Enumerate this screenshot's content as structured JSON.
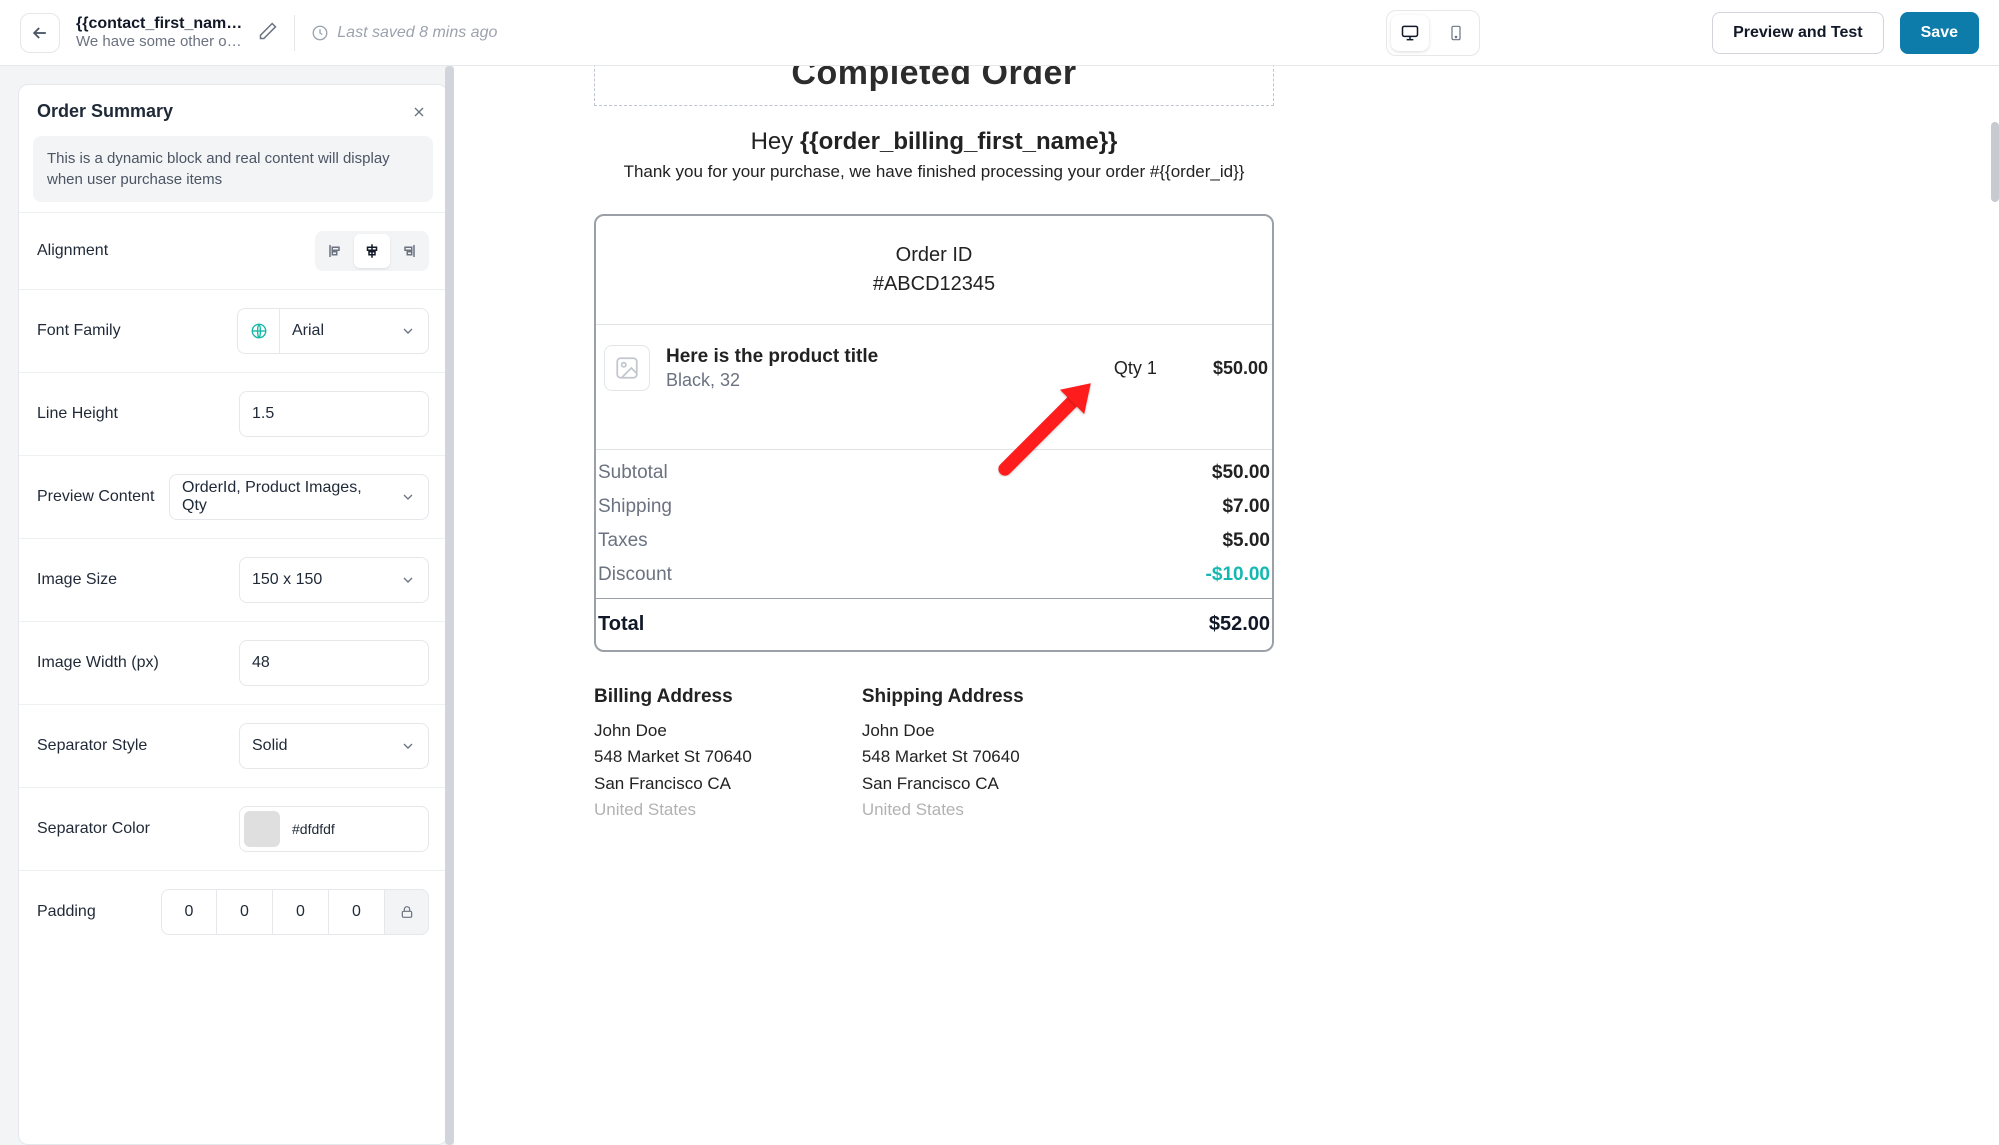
{
  "topbar": {
    "title": "{{contact_first_nam…",
    "subtitle": "We have some other o…",
    "last_saved": "Last saved 8 mins ago",
    "preview_btn": "Preview and Test",
    "save_btn": "Save"
  },
  "panel": {
    "title": "Order Summary",
    "notice": "This is a dynamic block and real content will display when user purchase items",
    "labels": {
      "alignment": "Alignment",
      "font_family": "Font Family",
      "line_height": "Line Height",
      "preview_content": "Preview Content",
      "image_size": "Image Size",
      "image_width": "Image Width (px)",
      "separator_style": "Separator Style",
      "separator_color": "Separator Color",
      "padding": "Padding"
    },
    "values": {
      "font_family": "Arial",
      "line_height": "1.5",
      "preview_content": "OrderId, Product Images, Qty",
      "image_size": "150 x 150",
      "image_width": "48",
      "separator_style": "Solid",
      "separator_color": "#dfdfdf",
      "padding_top": "0",
      "padding_right": "0",
      "padding_bottom": "0",
      "padding_left": "0"
    }
  },
  "email": {
    "header": "Completed Order",
    "hey_prefix": "Hey ",
    "hey_name": "{{order_billing_first_name}}",
    "thank": "Thank you for your purchase, we have finished processing your order #{{order_id}}",
    "order_id_label": "Order ID",
    "order_id_value": "#ABCD12345",
    "product": {
      "title": "Here is the product title",
      "variant": "Black, 32",
      "qty": "Qty 1",
      "price": "$50.00"
    },
    "totals": {
      "subtotal_label": "Subtotal",
      "subtotal_value": "$50.00",
      "shipping_label": "Shipping",
      "shipping_value": "$7.00",
      "taxes_label": "Taxes",
      "taxes_value": "$5.00",
      "discount_label": "Discount",
      "discount_value": "-$10.00",
      "total_label": "Total",
      "total_value": "$52.00"
    },
    "billing": {
      "title": "Billing Address",
      "name": "John Doe",
      "street": "548 Market St 70640",
      "city": "San Francisco CA",
      "country": "United States"
    },
    "shipping": {
      "title": "Shipping Address",
      "name": "John Doe",
      "street": "548 Market St 70640",
      "city": "San Francisco CA",
      "country": "United States"
    }
  }
}
